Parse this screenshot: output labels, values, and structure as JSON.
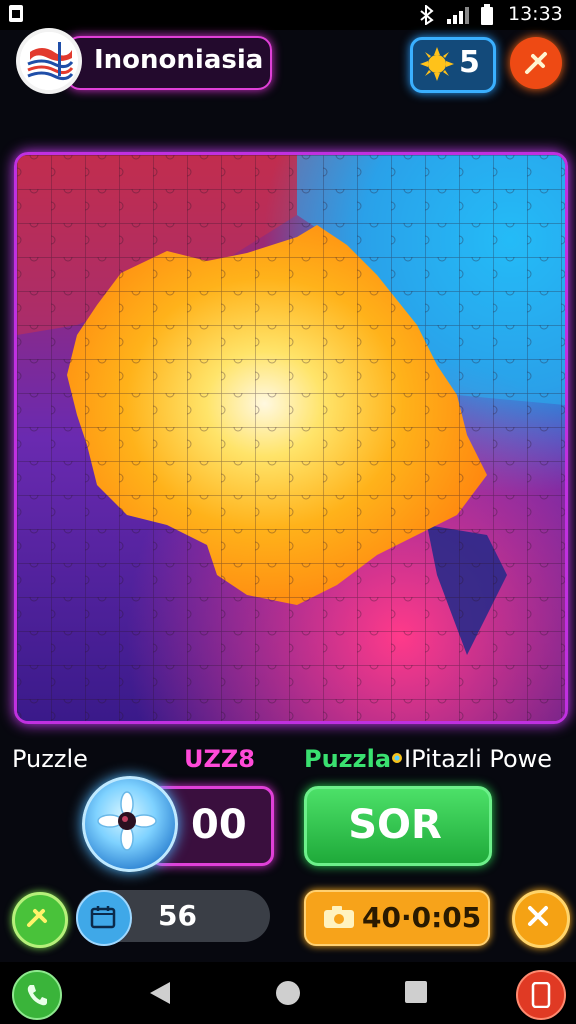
{
  "status_bar": {
    "time": "13:33"
  },
  "header": {
    "title": "Inononiasia",
    "coins": "5",
    "icons": [
      "flag-icon",
      "sun-icon",
      "hammer-icon"
    ]
  },
  "puzzle": {
    "image_theme": "Indonesia",
    "colors": {
      "frame": "#c030e0",
      "glow": "#ff7a30"
    }
  },
  "labels": {
    "left": "Puzzle",
    "center": "UZZ8",
    "right_green": "Puzzla",
    "right_white": "IPitazli Powe"
  },
  "score": {
    "value": "00"
  },
  "action_button": {
    "label": "SOR"
  },
  "moves": {
    "value": "56"
  },
  "timer": {
    "value": "40·0:05"
  },
  "colors": {
    "accent_pink": "#e040d8",
    "accent_blue": "#3ab0ff",
    "accent_green": "#2ac050",
    "accent_orange": "#f7a31a",
    "accent_red": "#ee4a14"
  }
}
